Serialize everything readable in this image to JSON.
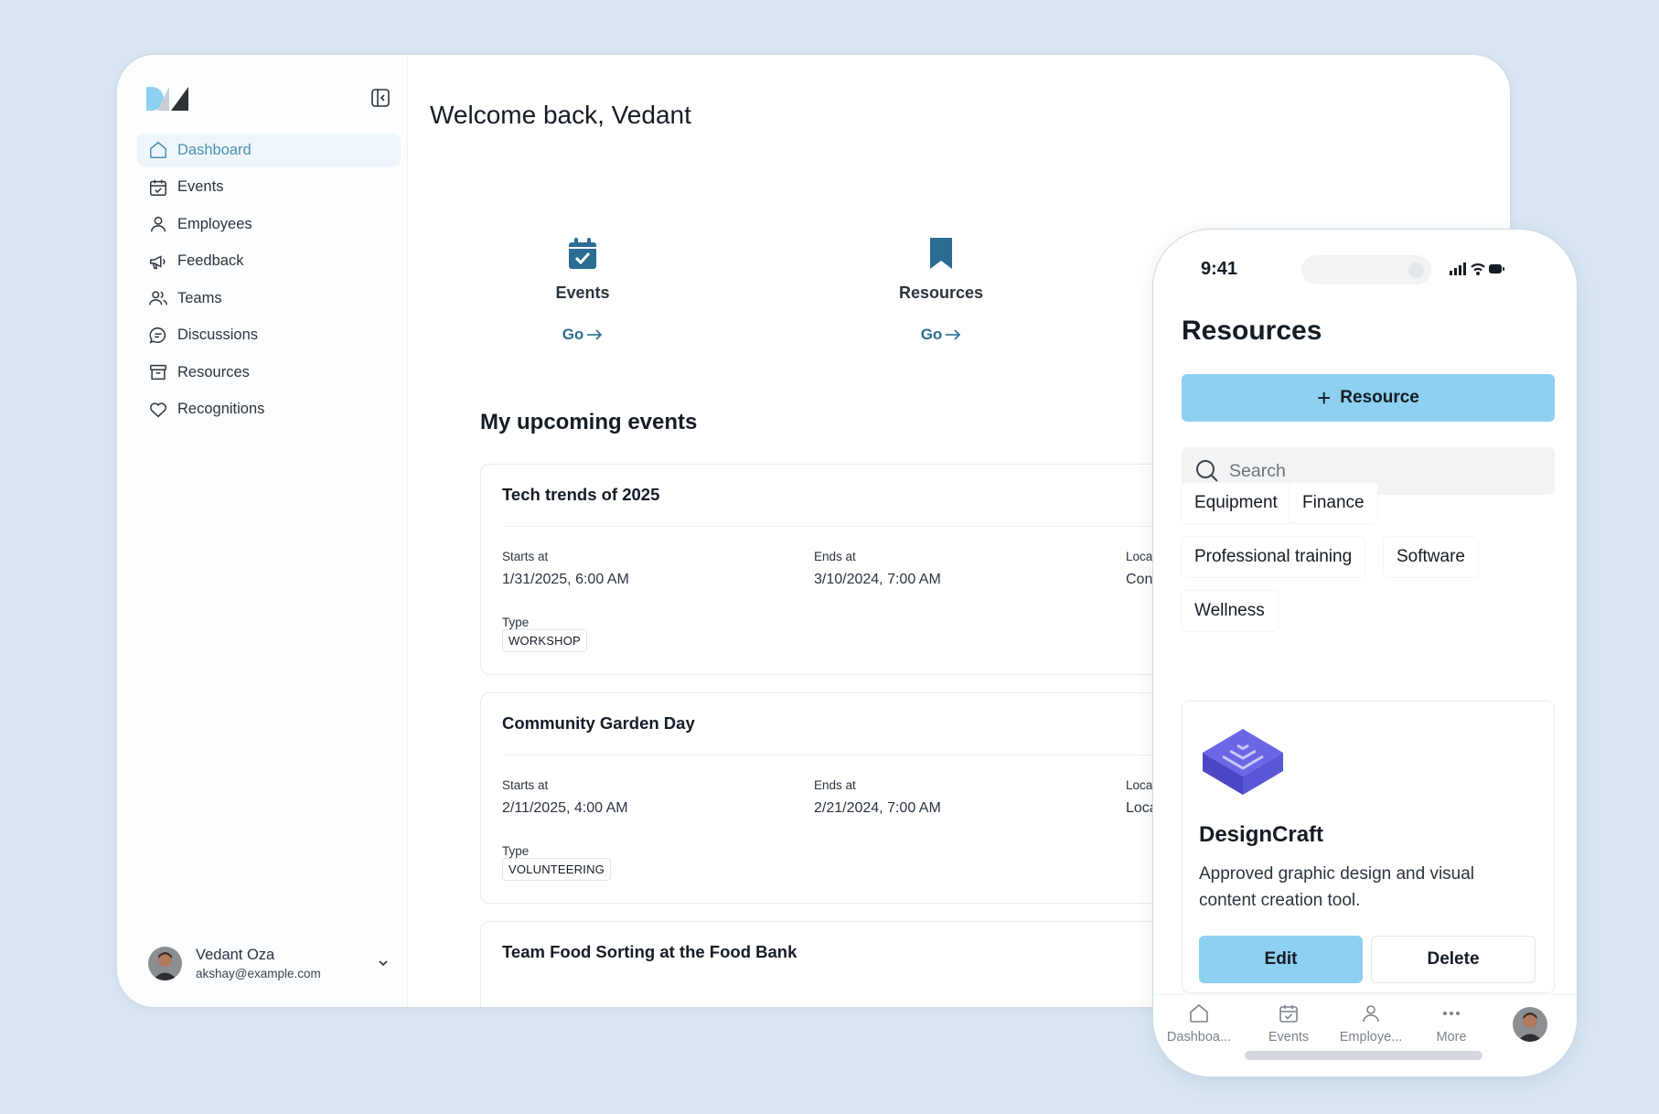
{
  "sidebar": {
    "items": [
      {
        "label": "Dashboard",
        "icon": "home-icon",
        "active": true
      },
      {
        "label": "Events",
        "icon": "calendar-check-icon"
      },
      {
        "label": "Employees",
        "icon": "user-icon"
      },
      {
        "label": "Feedback",
        "icon": "megaphone-icon"
      },
      {
        "label": "Teams",
        "icon": "users-icon"
      },
      {
        "label": "Discussions",
        "icon": "chat-bubble-icon"
      },
      {
        "label": "Resources",
        "icon": "archive-box-icon"
      },
      {
        "label": "Recognitions",
        "icon": "heart-icon"
      }
    ],
    "user": {
      "name": "Vedant Oza",
      "email": "akshay@example.com"
    }
  },
  "main": {
    "welcome": "Welcome back, Vedant",
    "quick_links": [
      {
        "label": "Events",
        "go": "Go",
        "icon": "calendar-check-filled-icon"
      },
      {
        "label": "Resources",
        "go": "Go",
        "icon": "bookmark-filled-icon"
      }
    ],
    "section_title": "My upcoming events",
    "events": [
      {
        "title": "Tech trends of 2025",
        "starts_label": "Starts at",
        "starts": "1/31/2025, 6:00 AM",
        "ends_label": "Ends at",
        "ends": "3/10/2024, 7:00 AM",
        "loc_label": "Loca",
        "loc": "Con",
        "type_label": "Type",
        "type": "WORKSHOP"
      },
      {
        "title": "Community Garden Day",
        "starts_label": "Starts at",
        "starts": "2/11/2025, 4:00 AM",
        "ends_label": "Ends at",
        "ends": "2/21/2024, 7:00 AM",
        "loc_label": "Loca",
        "loc": "Loca",
        "type_label": "Type",
        "type": "VOLUNTEERING"
      },
      {
        "title": "Team Food Sorting at the Food Bank"
      }
    ]
  },
  "phone": {
    "time": "9:41",
    "title": "Resources",
    "add_button": "Resource",
    "search_placeholder": "Search",
    "categories": [
      "Equipment",
      "Finance",
      "Professional training",
      "Software",
      "Wellness"
    ],
    "resource": {
      "name": "DesignCraft",
      "description": "Approved graphic design and visual content creation tool.",
      "edit": "Edit",
      "delete": "Delete"
    },
    "tabs": [
      {
        "label": "Dashboa...",
        "icon": "home-icon"
      },
      {
        "label": "Events",
        "icon": "calendar-check-icon"
      },
      {
        "label": "Employe...",
        "icon": "user-icon"
      },
      {
        "label": "More",
        "icon": "more-dots-icon"
      }
    ]
  },
  "colors": {
    "accent": "#8ed0ef",
    "link": "#2b6c93",
    "icon_fill": "#2b6c93",
    "background": "#d9e6f2"
  }
}
